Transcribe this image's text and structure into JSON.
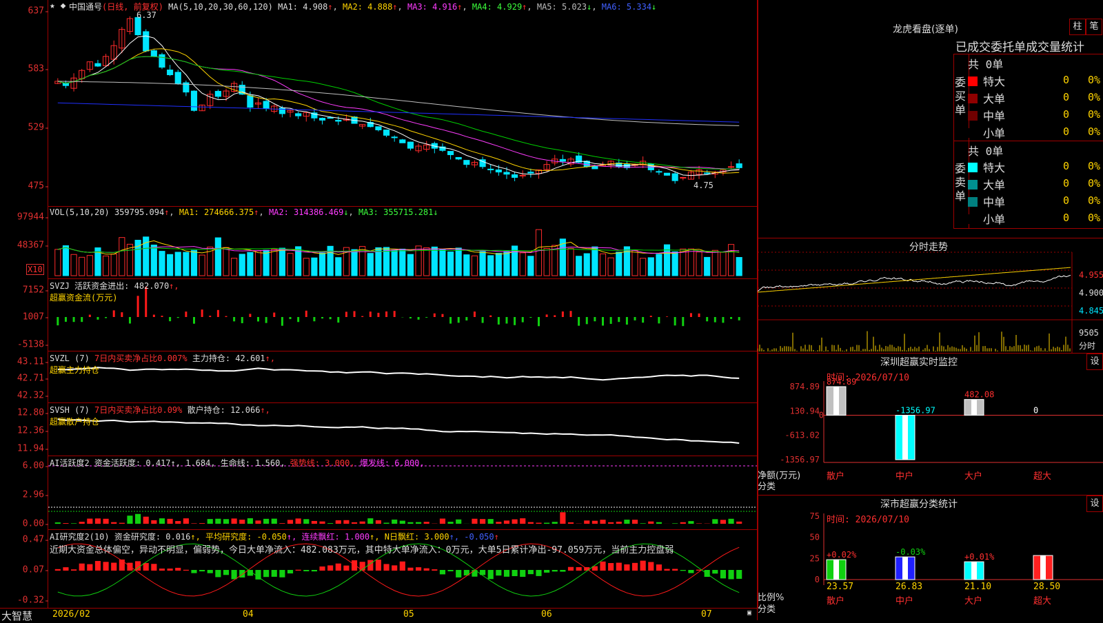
{
  "colors": {
    "up": "#ff2b2b",
    "down": "#00e5ff",
    "ma1": "#ffffff",
    "ma2": "#ffd400",
    "ma3": "#ff3cff",
    "ma4": "#00d000",
    "ma5": "#c0c0c0",
    "ma6": "#2030ff",
    "grid": "#a00000"
  },
  "kline": {
    "stock": "中国通号",
    "period": "(日线, 前复权)",
    "ma_label": "MA(5,10,20,30,60,120)",
    "ma1": "MA1: 4.908",
    "ma2": "MA2: 4.888",
    "ma3": "MA3: 4.916",
    "ma4": "MA4: 4.929",
    "ma5": "MA5: 5.023",
    "ma6": "MA6: 5.334",
    "arr_up": "↑",
    "arr_dn": "↓",
    "high_label": "6.37",
    "low_label": "4.75",
    "ticks": [
      "637",
      "583",
      "529",
      "475"
    ]
  },
  "vol": {
    "label": "VOL(5,10,20)",
    "v": "359795.094",
    "ma1": "MA1: 274666.375",
    "ma2": "MA2: 314386.469",
    "ma3": "MA3: 355715.281",
    "ticks": [
      "97944",
      "48367"
    ],
    "unit": "X10"
  },
  "svzj": {
    "label": "SVZJ",
    "text": "活跃资金进出: 482.070",
    "tail": "↑,",
    "sub": "超赢资金流(万元)",
    "ticks": [
      "7152",
      "1007",
      "-5138"
    ]
  },
  "svzl": {
    "label": "SVZL (7)",
    "pct": "7日内买卖净占比0.007%",
    "main": "主力持仓: 42.601",
    "tail": "↑,",
    "sub": "超赢主力持仓",
    "ticks": [
      "43.11",
      "42.71",
      "42.32"
    ]
  },
  "svsh": {
    "label": "SVSH (7)",
    "pct": "7日内买卖净占比0.09%",
    "main": "散户持仓: 12.066",
    "tail": "↑,",
    "sub": "超赢散户持仓",
    "ticks": [
      "12.80",
      "12.36",
      "11.94"
    ]
  },
  "ai1": {
    "label": "AI活跃度2",
    "a": "资金活跃度: 0.417",
    "b": "↑, 1.684",
    "c": ", 生命线: 1.560,",
    "d": "强势线: 3.000,",
    "e": "爆发线: 6.000,",
    "ticks": [
      "6.00",
      "2.96",
      "0.00"
    ]
  },
  "ai2": {
    "label": "AI研究度2(10)",
    "a": "资金研究度: 0.016",
    "b": "↑, 平均研究度: -0.050",
    "c": "↑, 连续飘红: 1.000",
    "d": "↑, N日飘红: 3.000",
    "e": "↑, -0.050",
    "f": "↑",
    "note": "近期大资金总体偏空，异动不明显，偏弱势，今日大单净流入：482.083万元，其中特大单净流入：0万元，大单5日累计净出-97.059万元，当前主力控盘弱",
    "ticks": [
      "0.47",
      "0.07",
      "-0.32"
    ]
  },
  "xaxis": {
    "brand": "大智慧",
    "labels": [
      "2026/02",
      "04",
      "05",
      "06",
      "07"
    ]
  },
  "right": {
    "dragon_title": "龙虎看盘(逐单)",
    "btn_zhu": "柱",
    "btn_bi": "笔",
    "table_title": "已成交委托单成交量统计",
    "buy": {
      "side": "委买单",
      "total": "共 0单",
      "rows": [
        {
          "name": "特大",
          "n": "0",
          "p": "0%",
          "c": "#ff0000"
        },
        {
          "name": "大单",
          "n": "0",
          "p": "0%",
          "c": "#900000"
        },
        {
          "name": "中单",
          "n": "0",
          "p": "0%",
          "c": "#700000"
        },
        {
          "name": "小单",
          "n": "0",
          "p": "0%",
          "c": "#000000"
        }
      ]
    },
    "sell": {
      "side": "委卖单",
      "total": "共 0单",
      "rows": [
        {
          "name": "特大",
          "n": "0",
          "p": "0%",
          "c": "#00ffff"
        },
        {
          "name": "大单",
          "n": "0",
          "p": "0%",
          "c": "#009090"
        },
        {
          "name": "中单",
          "n": "0",
          "p": "0%",
          "c": "#008080"
        },
        {
          "name": "小单",
          "n": "0",
          "p": "0%",
          "c": "#000000"
        }
      ]
    },
    "intraday": {
      "title": "分时走势",
      "ticks": [
        "4.955",
        "4.900",
        "4.845"
      ],
      "vol_tick": "9505",
      "vol_label": "分时"
    },
    "monitor": {
      "title": "深圳超赢实时监控",
      "btn": "设",
      "time": "时间: 2026/07/10",
      "ticks": [
        "874.89",
        "130.94",
        "-613.02",
        "-1356.97"
      ],
      "zero": "0",
      "unit": "净额(万元)",
      "cat_label": "分类",
      "bars": [
        {
          "cat": "散户",
          "v": 874.89,
          "label": "874.89"
        },
        {
          "cat": "中户",
          "v": -1356.97,
          "label": "-1356.97"
        },
        {
          "cat": "大户",
          "v": 482.08,
          "label": "482.08"
        },
        {
          "cat": "超大",
          "v": 0,
          "label": "0"
        }
      ]
    },
    "stats": {
      "title": "深市超赢分类统计",
      "btn": "设",
      "time": "时间: 2026/07/10",
      "ticks": [
        "75",
        "50",
        "25",
        "0"
      ],
      "unit": "比例%",
      "cat_label": "分类",
      "bars": [
        {
          "cat": "散户",
          "v": 23.57,
          "chg": "+0.02%"
        },
        {
          "cat": "中户",
          "v": 26.83,
          "chg": "-0.03%"
        },
        {
          "cat": "大户",
          "v": 21.1,
          "chg": "+0.01%"
        },
        {
          "cat": "超大",
          "v": 28.5,
          "chg": ""
        }
      ]
    }
  },
  "chart_data": [
    {
      "type": "candlestick",
      "title": "中国通号(日线, 前复权)",
      "ylim": [
        4.75,
        6.37
      ],
      "series": [
        {
          "name": "MA1"
        },
        {
          "name": "MA2"
        },
        {
          "name": "MA3"
        },
        {
          "name": "MA4"
        },
        {
          "name": "MA5"
        },
        {
          "name": "MA6"
        }
      ],
      "close": [
        5.72,
        5.68,
        5.75,
        5.82,
        5.9,
        5.86,
        5.95,
        6.05,
        6.2,
        6.3,
        6.15,
        6.0,
        5.95,
        5.85,
        5.78,
        5.7,
        5.62,
        5.45,
        5.5,
        5.6,
        5.58,
        5.63,
        5.7,
        5.6,
        5.48,
        5.52,
        5.47,
        5.49,
        5.42,
        5.45,
        5.4,
        5.43,
        5.38,
        5.36,
        5.38,
        5.35,
        5.37,
        5.33,
        5.32,
        5.3,
        5.27,
        5.22,
        5.2,
        5.15,
        5.1,
        5.12,
        5.13,
        5.1,
        5.08,
        5.04,
        5.0,
        4.95,
        4.97,
        4.93,
        4.9,
        4.88,
        4.86,
        4.83,
        4.85,
        4.87,
        4.9,
        4.95,
        5.0,
        4.98,
        5.0,
        4.97,
        4.93,
        4.91,
        4.95,
        4.98,
        4.93,
        4.92,
        4.95,
        4.98,
        4.9,
        4.88,
        4.85,
        4.8,
        4.83,
        4.88,
        4.9,
        4.87,
        4.88,
        4.9,
        4.93,
        4.92
      ]
    },
    {
      "type": "bar",
      "title": "龙虎看盘 深圳超赢实时监控",
      "categories": [
        "散户",
        "中户",
        "大户",
        "超大"
      ],
      "values": [
        874.89,
        -1356.97,
        482.08,
        0
      ],
      "ylabel": "净额(万元)",
      "ylim": [
        -1356.97,
        874.89
      ]
    },
    {
      "type": "bar",
      "title": "深市超赢分类统计",
      "categories": [
        "散户",
        "中户",
        "大户",
        "超大"
      ],
      "values": [
        23.57,
        26.83,
        21.1,
        28.5
      ],
      "ylabel": "比例%",
      "ylim": [
        0,
        75
      ]
    }
  ]
}
